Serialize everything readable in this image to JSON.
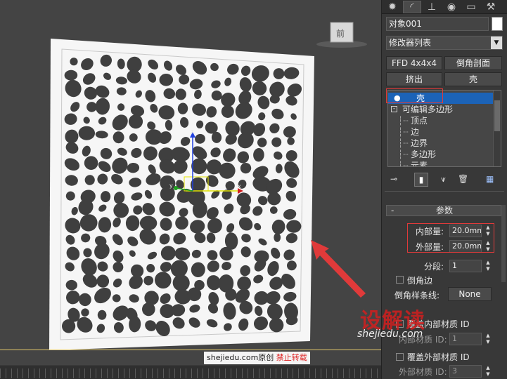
{
  "viewport": {
    "gizmo_axes": [
      "x",
      "y",
      "z"
    ],
    "viewcube_label": "前"
  },
  "tabs": [
    "create-icon",
    "modify-icon",
    "hierarchy-icon",
    "motion-icon",
    "display-icon",
    "utilities-icon"
  ],
  "object_name": "对象001",
  "modifier_list": "修改器列表",
  "buttons": {
    "ffd": "FFD 4x4x4",
    "bevel_profile": "倒角剖面",
    "extrude": "挤出",
    "shell": "壳"
  },
  "stack": {
    "items": [
      {
        "label": "壳",
        "selected": true
      },
      {
        "label": "可编辑多边形",
        "selected": false
      },
      {
        "label": "顶点",
        "selected": false
      },
      {
        "label": "边",
        "selected": false
      },
      {
        "label": "边界",
        "selected": false
      },
      {
        "label": "多边形",
        "selected": false
      },
      {
        "label": "元素",
        "selected": false
      }
    ]
  },
  "params": {
    "rollout_sign": "-",
    "rollout_title": "参数",
    "inner_label": "内部量:",
    "inner_value": "20.0mm",
    "outer_label": "外部量:",
    "outer_value": "20.0mm",
    "segments_label": "分段:",
    "segments_value": "1",
    "bevel_edges_label": "倒角边",
    "bevel_spline_label": "倒角样条线:",
    "bevel_spline_value": "None",
    "override_inner_label": "覆盖内部材质 ID",
    "inner_mat_label": "内部材质 ID:",
    "inner_mat_value": "1",
    "override_outer_label": "覆盖外部材质 ID",
    "outer_mat_label": "外部材质 ID:",
    "outer_mat_value": "3"
  },
  "watermark": {
    "site": "shejiedu.com原创",
    "notice": "禁止转载",
    "logo_text": "设解读",
    "logo_url": "shejiedu.com"
  },
  "colors": {
    "accent_red": "#e03a3a",
    "selection_blue": "#1c63b7"
  }
}
